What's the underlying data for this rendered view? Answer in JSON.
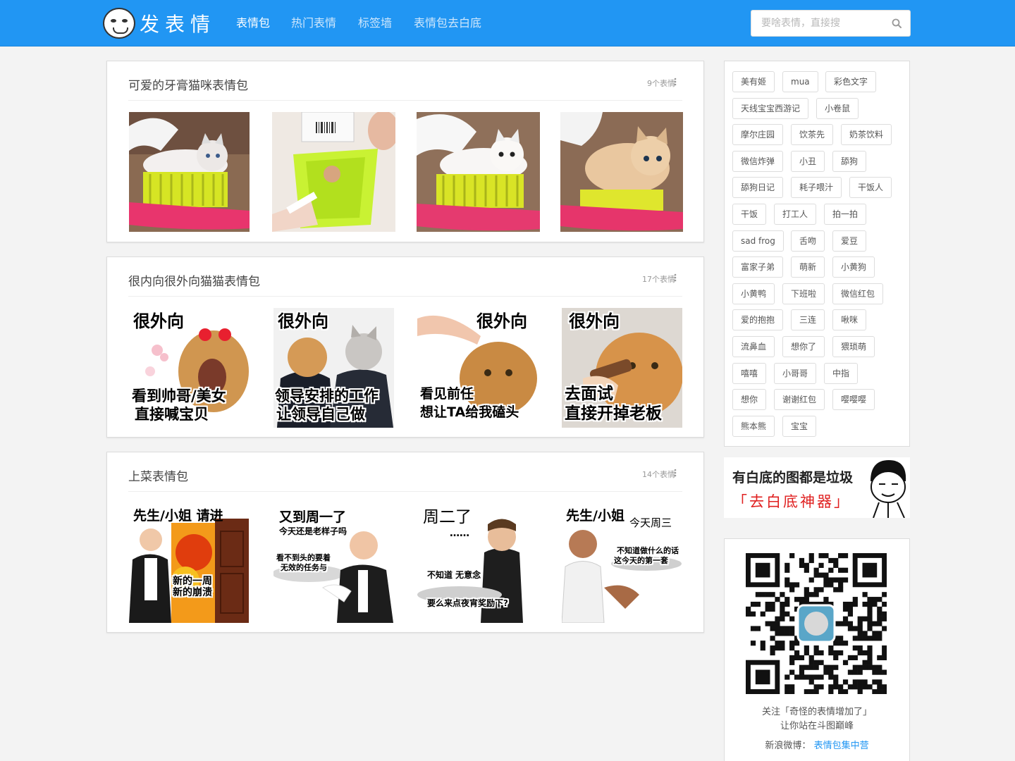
{
  "brand": {
    "name": "发表情"
  },
  "nav": [
    {
      "label": "表情包",
      "active": true
    },
    {
      "label": "热门表情",
      "active": false
    },
    {
      "label": "标签墙",
      "active": false
    },
    {
      "label": "表情包去白底",
      "active": false
    }
  ],
  "search": {
    "placeholder": "要啥表情，直接搜",
    "icon": "search-icon"
  },
  "packs": [
    {
      "title": "可爱的牙膏猫咪表情包",
      "count": "9个表情",
      "items": [
        {
          "kind": "cat-toothbrush"
        },
        {
          "kind": "toothpaste-cup"
        },
        {
          "kind": "cat-toothbrush-white"
        },
        {
          "kind": "kitten-toothbrush"
        }
      ]
    },
    {
      "title": "很内向很外向猫猫表情包",
      "count": "17个表情",
      "items": [
        {
          "top": "很外向",
          "bottom1": "看到帅哥/美女",
          "bottom2": "直接喊宝贝"
        },
        {
          "top": "很外向",
          "bottom1": "领导安排的工作",
          "bottom2": "让领导自己做"
        },
        {
          "top": "很外向",
          "bottom1": "看见前任",
          "bottom2": "想让TA给我磕头"
        },
        {
          "top": "很外向",
          "bottom1": "去面试",
          "bottom2": "直接开掉老板"
        }
      ]
    },
    {
      "title": "上菜表情包",
      "count": "14个表情",
      "items": [
        {
          "top": "先生/小姐  请进",
          "sub": "",
          "plate1": "新的一周",
          "plate2": "新的崩溃"
        },
        {
          "top": "又到周一了",
          "sub": "今天还是老样子吗",
          "plate1": "看不到头的要着",
          "plate2": "无效的任务与"
        },
        {
          "top": "周二了",
          "sub": "……",
          "plate1": "不知道 无意念",
          "plate2": "要么来点夜宵奖励下?"
        },
        {
          "top": "先生/小姐",
          "sub": "今天周三",
          "plate1": "不知道做什么的话",
          "plate2": "这今天的第一套"
        }
      ]
    }
  ],
  "tags": [
    [
      "美有姬",
      "mua",
      "彩色文字"
    ],
    [
      "天线宝宝西游记",
      "小卷鼠"
    ],
    [
      "摩尔庄园",
      "饮茶先",
      "奶茶饮料"
    ],
    [
      "微信炸弹",
      "小丑",
      "舔狗"
    ],
    [
      "舔狗日记",
      "耗子喂汁",
      "干饭人"
    ],
    [
      "干饭",
      "打工人",
      "拍一拍"
    ],
    [
      "sad frog",
      "舌吻",
      "爱豆"
    ],
    [
      "富家子弟",
      "萌新",
      "小黄狗"
    ],
    [
      "小黄鸭",
      "下班啦",
      "微信红包"
    ],
    [
      "爱的抱抱",
      "三连",
      "啾咪"
    ],
    [
      "流鼻血",
      "想你了",
      "猥琐萌"
    ],
    [
      "嘻嘻",
      "小哥哥",
      "中指"
    ],
    [
      "想你",
      "谢谢红包",
      "嘤嘤嘤"
    ],
    [
      "熊本熊",
      "宝宝"
    ]
  ],
  "banner": {
    "line1": "有白底的图都是垃圾",
    "line2": "「去白底神器」"
  },
  "follow": {
    "line1": "关注「奇怪的表情增加了」",
    "line2": "让你站在斗图巅峰",
    "weibo_label": "新浪微博：",
    "weibo_link": "表情包集中营"
  },
  "colors": {
    "primary": "#2196f3",
    "accent_red": "#e02020"
  }
}
